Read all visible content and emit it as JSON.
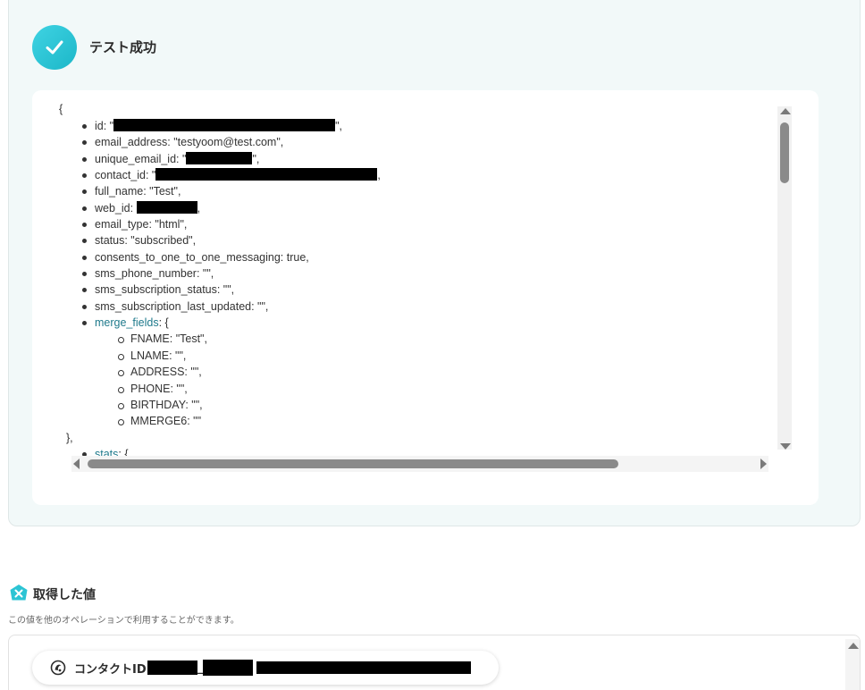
{
  "result": {
    "title": "テスト成功",
    "icon": "check-circle-icon",
    "accent_color": "#2cc4d4"
  },
  "code": {
    "open_brace": "{",
    "items": [
      {
        "text_before": "id: \"",
        "text_after": "\","
      },
      {
        "text": "email_address: \"testyoom@test.com\","
      },
      {
        "text_before": "unique_email_id: \"",
        "text_after": "\","
      },
      {
        "text_before": "contact_id: \"",
        "text_after": ","
      },
      {
        "text": "full_name: \"Test\","
      },
      {
        "text_before": "web_id: ",
        "text_after": ","
      },
      {
        "text": "email_type: \"html\","
      },
      {
        "text": "status: \"subscribed\","
      },
      {
        "text": "consents_to_one_to_one_messaging: true,"
      },
      {
        "text": "sms_phone_number: \"\","
      },
      {
        "text": "sms_subscription_status: \"\","
      },
      {
        "text": "sms_subscription_last_updated: \"\","
      }
    ],
    "merge_fields_key": "merge_fields",
    "merge_fields_open": ": {",
    "merge_fields": [
      "FNAME: \"Test\",",
      "LNAME: \"\",",
      "ADDRESS: \"\",",
      "PHONE: \"\",",
      "BIRTHDAY: \"\",",
      "MMERGE6: \"\""
    ],
    "merge_fields_close": "},",
    "stats_key": "stats",
    "stats_open": ": {"
  },
  "values_section": {
    "title": "取得した値",
    "description": "この値を他のオペレーションで利用することができます。",
    "icon": "cross-badge-icon",
    "pill_label": "コンタクトID",
    "pill_sep": "_",
    "pill_icon": "mailchimp-icon"
  }
}
